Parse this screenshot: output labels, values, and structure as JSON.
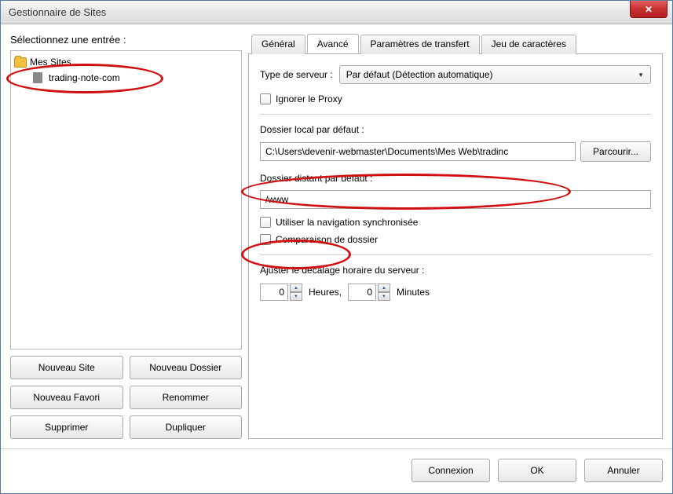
{
  "window": {
    "title": "Gestionnaire de Sites"
  },
  "left": {
    "select_label": "Sélectionnez une entrée :",
    "root_folder": "Mes Sites",
    "site_name": "trading-note-com",
    "buttons": {
      "new_site": "Nouveau Site",
      "new_folder": "Nouveau Dossier",
      "new_fav": "Nouveau Favori",
      "rename": "Renommer",
      "delete": "Supprimer",
      "duplicate": "Dupliquer"
    }
  },
  "tabs": {
    "general": "Général",
    "advanced": "Avancé",
    "transfer": "Paramètres de transfert",
    "charset": "Jeu de caractères"
  },
  "adv": {
    "server_type_label": "Type de serveur :",
    "server_type_value": "Par défaut (Détection automatique)",
    "ignore_proxy": "Ignorer le Proxy",
    "local_dir_label": "Dossier local par défaut :",
    "local_dir_value": "C:\\Users\\devenir-webmaster\\Documents\\Mes Web\\tradinc",
    "browse": "Parcourir...",
    "remote_dir_label": "Dossier distant par défaut :",
    "remote_dir_value": "/www",
    "sync_nav": "Utiliser la navigation synchronisée",
    "compare": "Comparaison de dossier",
    "time_label": "Ajuster le décalage horaire du serveur :",
    "hours_value": "0",
    "hours_label": "Heures,",
    "minutes_value": "0",
    "minutes_label": "Minutes"
  },
  "footer": {
    "connect": "Connexion",
    "ok": "OK",
    "cancel": "Annuler"
  }
}
